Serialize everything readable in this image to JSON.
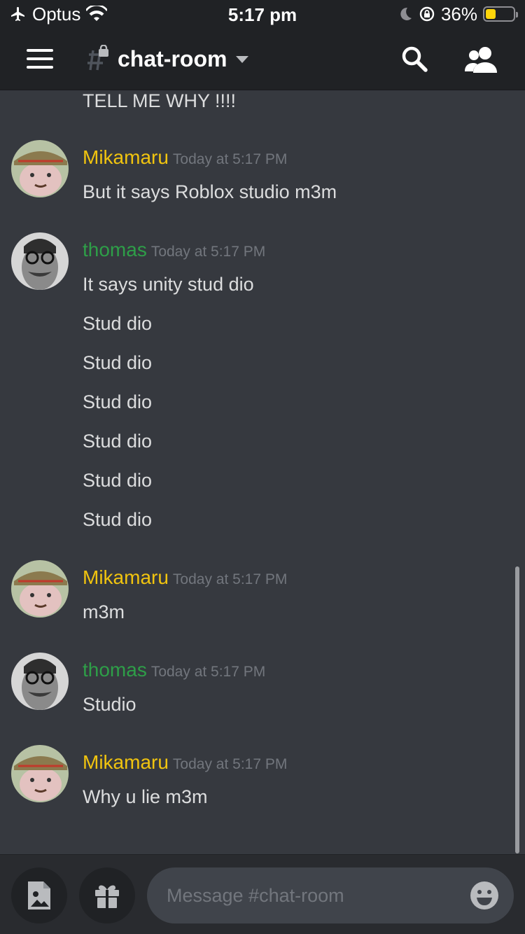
{
  "status_bar": {
    "carrier": "Optus",
    "time": "5:17 pm",
    "battery_percent": "36%",
    "battery_level": 0.36,
    "battery_color": "#ffd60a"
  },
  "header": {
    "channel_name": "chat-room",
    "icons": [
      "hamburger-menu-icon",
      "locked-channel-hash-icon",
      "chevron-down-icon",
      "search-icon",
      "members-icon"
    ]
  },
  "messages": {
    "partial_top": "TELL ME WHY !!!!",
    "groups": [
      {
        "author": "Mikamaru",
        "author_color": "#f1c40f",
        "timestamp": "Today at 5:17 PM",
        "lines": [
          "But it says Roblox studio m3m"
        ]
      },
      {
        "author": "thomas",
        "author_color": "#2e9e48",
        "timestamp": "Today at 5:17 PM",
        "lines": [
          "It says unity stud dio",
          "Stud dio",
          "Stud dio",
          "Stud dio",
          "Stud dio",
          "Stud dio",
          "Stud dio"
        ]
      },
      {
        "author": "Mikamaru",
        "author_color": "#f1c40f",
        "timestamp": "Today at 5:17 PM",
        "lines": [
          "m3m"
        ]
      },
      {
        "author": "thomas",
        "author_color": "#2e9e48",
        "timestamp": "Today at 5:17 PM",
        "lines": [
          "Studio"
        ]
      },
      {
        "author": "Mikamaru",
        "author_color": "#f1c40f",
        "timestamp": "Today at 5:17 PM",
        "lines": [
          "Why u lie m3m"
        ]
      }
    ]
  },
  "composer": {
    "placeholder": "Message #chat-room",
    "icons": [
      "image-upload-icon",
      "gift-icon",
      "emoji-icon"
    ]
  }
}
